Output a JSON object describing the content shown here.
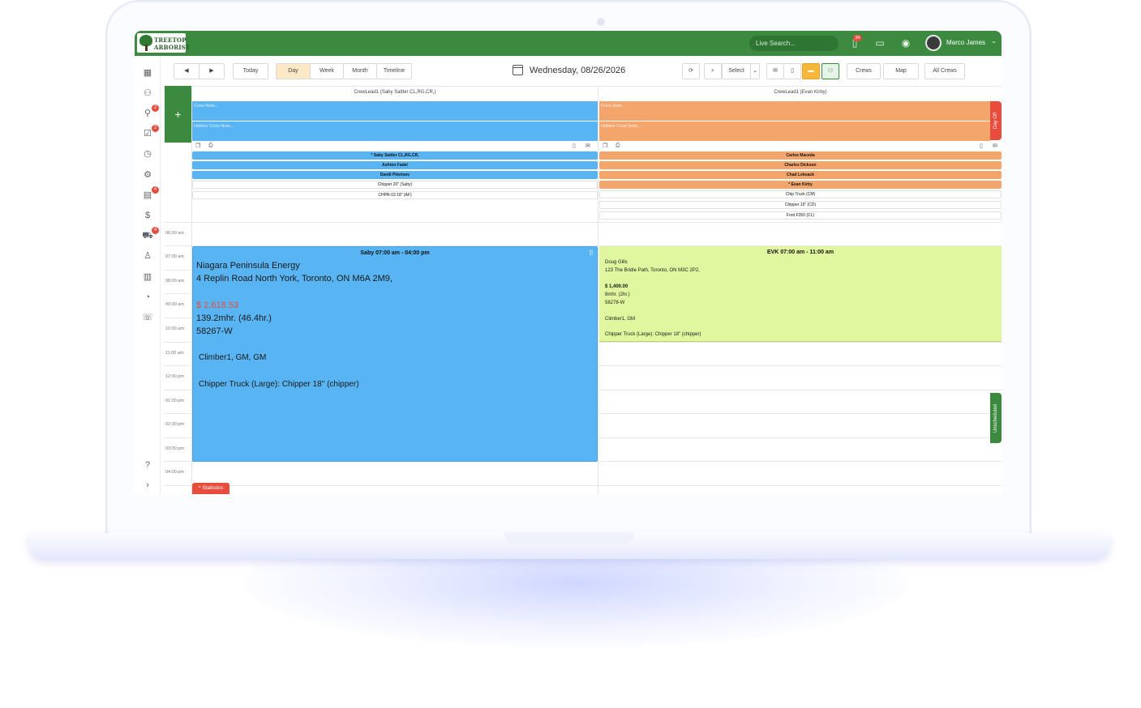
{
  "brand": {
    "line1": "TREETOP",
    "line2": "ARBORIST"
  },
  "topbar": {
    "search_placeholder": "Live Search...",
    "notification_count": "34",
    "user_name": "Marco James"
  },
  "sidebar": {
    "badges": {
      "leads": "2",
      "tasks": "2",
      "schedule": "4",
      "equipment": "4"
    }
  },
  "toolbar": {
    "prev_icon": "◀",
    "next_icon": "▶",
    "today": "Today",
    "views": [
      "Day",
      "Week",
      "Month",
      "Timeline"
    ],
    "date": "Wednesday, 08/26/2026",
    "select": "Select",
    "crews": "Crews",
    "map": "Map",
    "all_crews": "All Crews"
  },
  "crews": [
    {
      "header": "CrewLead1 (Saby Sattler CL,RG,CR,)",
      "crew_note": "Crew Note...",
      "hidden_note": "Hidden Crew Note...",
      "members": [
        "* Saby Sattler CL,RG,CR,",
        "Ashton Fadel",
        "Daniil Pitertsev"
      ],
      "equipment": [
        "Chipper 20\" (Saby)",
        "CHPR-03 18\" (AF)"
      ]
    },
    {
      "header": "CrewLead1 (Evan Kirby)",
      "crew_note": "Crew Note...",
      "hidden_note": "Hidden Crew Note...",
      "members": [
        "Carlos Maceda",
        "Charles Dickson",
        "Chad Lebsack",
        "* Evan Kirby"
      ],
      "equipment": [
        "Chip Truck (CM)",
        "Chipper 15\" (CD)",
        "Ford F350 (CL)"
      ]
    }
  ],
  "side_tabs": {
    "day_off": "Day Off",
    "unscheduled": "Unscheduled"
  },
  "times": [
    "06:00 am",
    "07:00 am",
    "08:00 am",
    "09:00 am",
    "10:00 am",
    "11:00 am",
    "12:00 pm",
    "01:00 pm",
    "02:00 pm",
    "03:00 pm",
    "04:00 pm"
  ],
  "events": {
    "blue": {
      "header": "Saby 07:00 am - 04:00 pm",
      "client": "Niagara Peninsula Energy",
      "address": "4 Replin Road North York, Toronto, ON M6A 2M9,",
      "amount": "$ 2,618.53",
      "hours": "139.2mhr. (46.4hr.)",
      "job": "58267-W",
      "crew": "Climber1, GM, GM",
      "equipment": "Chipper Truck (Large): Chipper 18\" (chipper)"
    },
    "green": {
      "header": "EVK 07:00 am - 11:00 am",
      "client": "Doug Gills",
      "address": "123 The Bridle Path, Toronto, ON M3C 2P2,",
      "amount": "$ 1,400.00",
      "hours": "8mhr. (2hr.)",
      "job": "58278-W",
      "crew": "Climber1, GM",
      "equipment": "Chipper Truck (Large): Chipper 18\" (chipper)"
    }
  },
  "statistics": "^ Statistics"
}
